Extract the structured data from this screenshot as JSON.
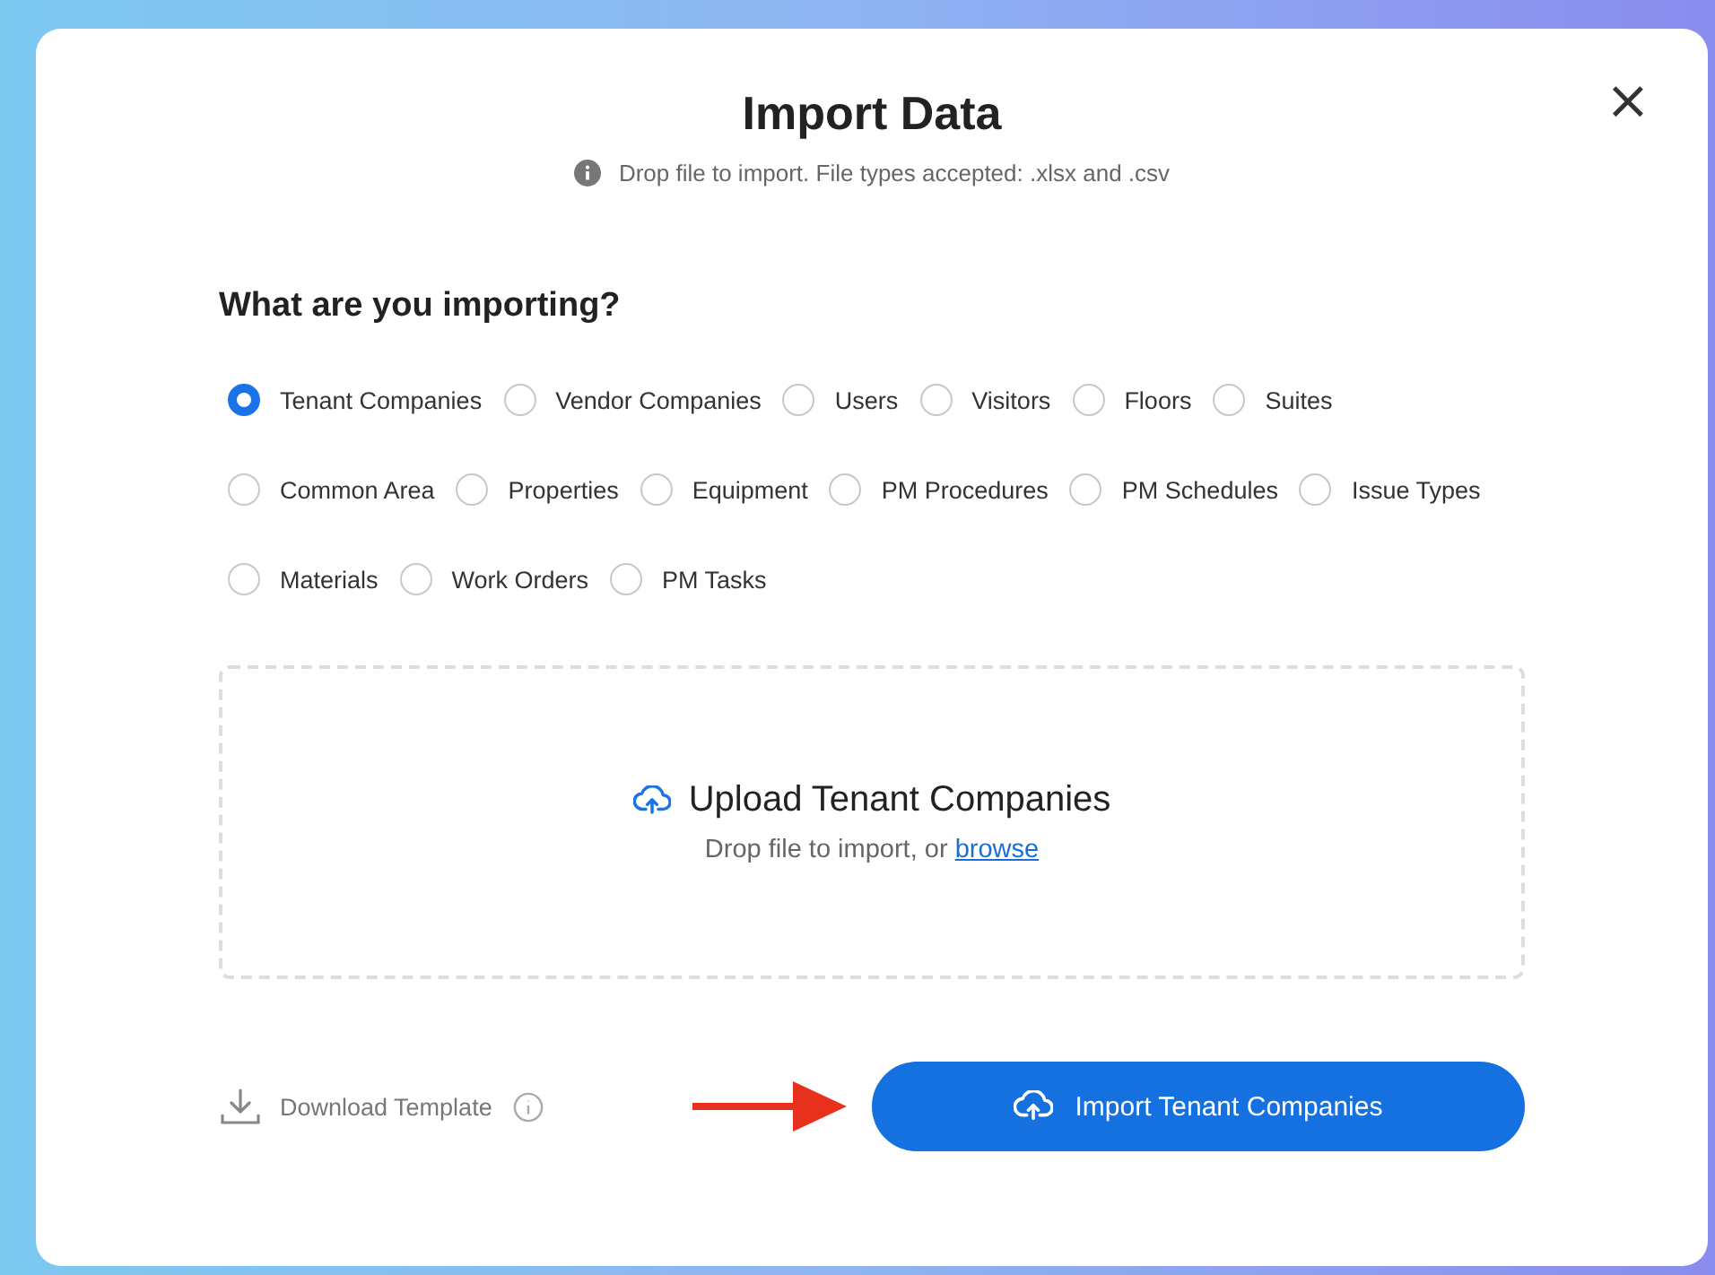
{
  "dialog": {
    "title": "Import Data",
    "subtitle": "Drop file to import. File types accepted: .xlsx and .csv",
    "close": "×"
  },
  "question": "What are you importing?",
  "option_rows": [
    [
      {
        "label": "Tenant Companies",
        "selected": true
      },
      {
        "label": "Vendor Companies",
        "selected": false
      },
      {
        "label": "Users",
        "selected": false
      },
      {
        "label": "Visitors",
        "selected": false
      },
      {
        "label": "Floors",
        "selected": false
      },
      {
        "label": "Suites",
        "selected": false
      }
    ],
    [
      {
        "label": "Common Area",
        "selected": false
      },
      {
        "label": "Properties",
        "selected": false
      },
      {
        "label": "Equipment",
        "selected": false
      },
      {
        "label": "PM Procedures",
        "selected": false
      },
      {
        "label": "PM Schedules",
        "selected": false
      },
      {
        "label": "Issue Types",
        "selected": false
      }
    ],
    [
      {
        "label": "Materials",
        "selected": false
      },
      {
        "label": "Work Orders",
        "selected": false
      },
      {
        "label": "PM Tasks",
        "selected": false
      }
    ]
  ],
  "dropzone": {
    "title": "Upload Tenant Companies",
    "hint": "Drop file to import, or",
    "link": "browse"
  },
  "footer": {
    "download": "Download Template",
    "import_button": "Import Tenant Companies"
  }
}
